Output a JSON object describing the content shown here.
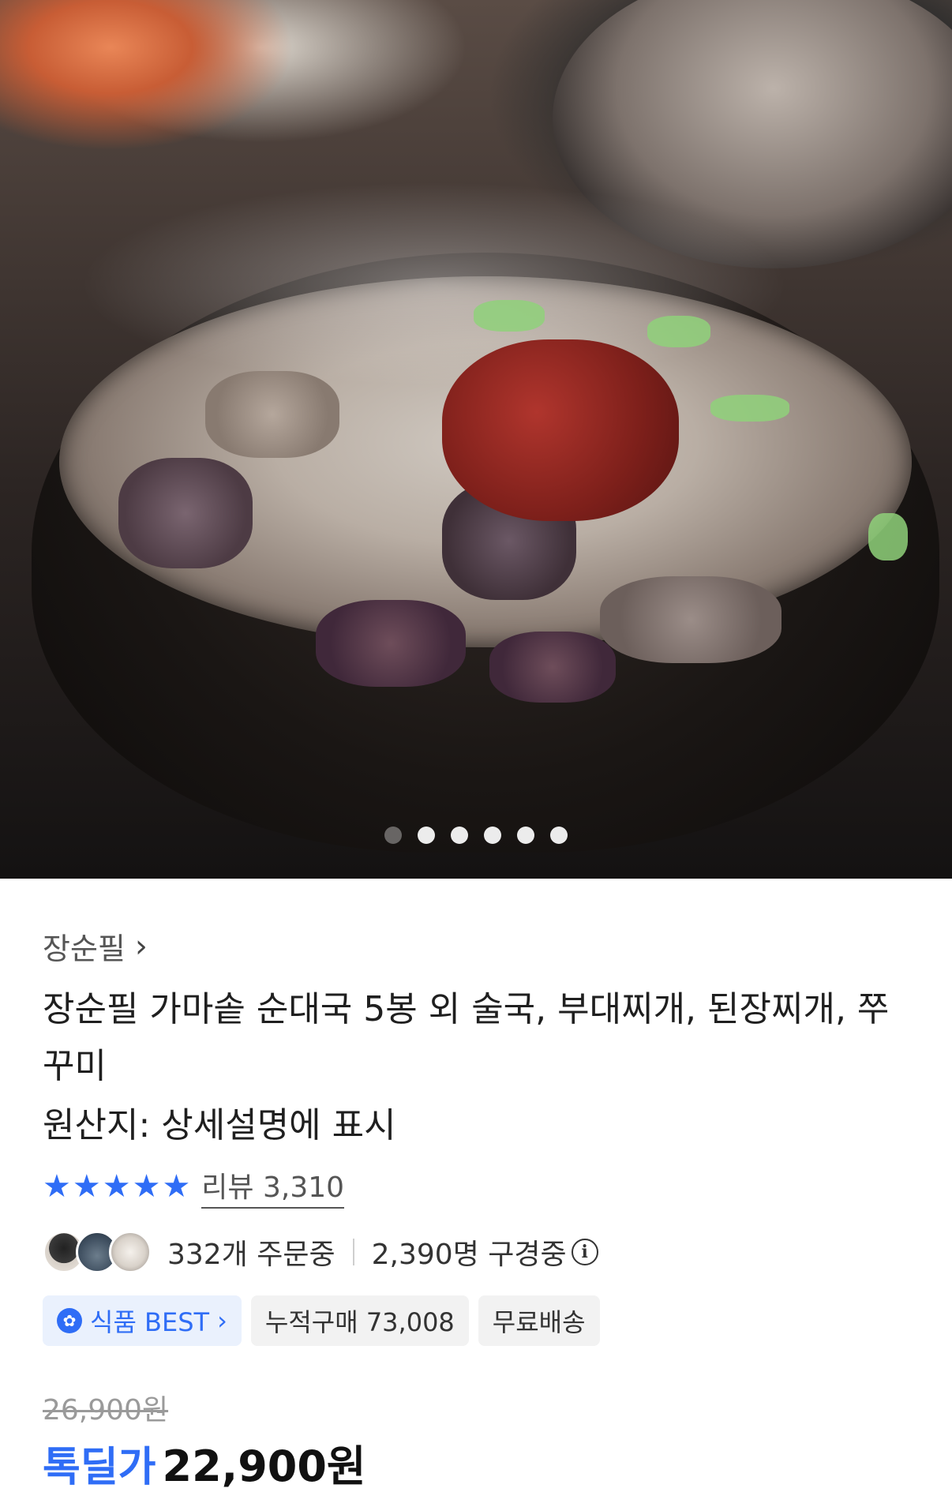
{
  "gallery": {
    "image_alt": "Sundae soup in stone pot",
    "slide_count": 6,
    "active_index": 0
  },
  "product": {
    "seller": "장순필",
    "title": "장순필 가마솥 순대국 5봉 외 술국, 부대찌개, 된장찌개, 쭈꾸미",
    "origin": "원산지: 상세설명에 표시",
    "rating_stars": 5,
    "review_label": "리뷰 3,310",
    "orders_label": "332개 주문중",
    "watching_label": "2,390명 구경중",
    "tags": {
      "best": "식품 BEST",
      "cumulative": "누적구매 73,008",
      "shipping": "무료배송"
    },
    "original_price": "26,900원",
    "sale_label": "톡딜가",
    "sale_price": "22,900원"
  },
  "colors": {
    "accent": "#2f6df6",
    "star": "#2f6df6"
  }
}
